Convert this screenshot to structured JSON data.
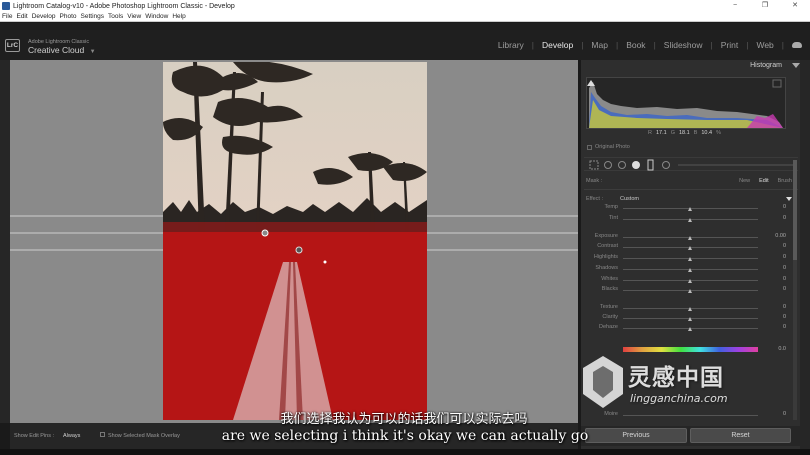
{
  "window": {
    "title": "Lightroom Catalog-v10 - Adobe Photoshop Lightroom Classic - Develop",
    "controls": [
      "−",
      "❐",
      "✕"
    ]
  },
  "menubar": [
    "File",
    "Edit",
    "Develop",
    "Photo",
    "Settings",
    "Tools",
    "View",
    "Window",
    "Help"
  ],
  "identity_plate": {
    "badge": "LrC",
    "line1": "Adobe Lightroom Classic",
    "line2": "Creative Cloud",
    "dropdown": "▼"
  },
  "modules": {
    "items": [
      "Library",
      "Develop",
      "Map",
      "Book",
      "Slideshow",
      "Print",
      "Web"
    ],
    "active": "Develop",
    "separator": "|"
  },
  "toolbar": {
    "show_edit_pins_label": "Show Edit Pins :",
    "show_edit_pins_value": "Always",
    "show_overlay_label": "Show Selected Mask Overlay",
    "show_overlay_checked": true
  },
  "histogram": {
    "title": "Histogram",
    "r_label": "R",
    "r_value": "17.1",
    "g_label": "G",
    "g_value": "18.1",
    "b_label": "B",
    "b_value": "10.4",
    "unit": "%",
    "original_photo": "Original Photo"
  },
  "mask": {
    "label": "Mask :",
    "new": "New",
    "edit": "Edit",
    "brush": "Brush",
    "active": "Edit"
  },
  "effect": {
    "label": "Effect :",
    "value": "Custom"
  },
  "sliders": [
    {
      "label": "Temp",
      "value": "0",
      "pos": 0.5
    },
    {
      "label": "Tint",
      "value": "0",
      "pos": 0.5
    },
    {
      "label": "Exposure",
      "value": "0.00",
      "pos": 0.5
    },
    {
      "label": "Contrast",
      "value": "0",
      "pos": 0.5
    },
    {
      "label": "Highlights",
      "value": "0",
      "pos": 0.5
    },
    {
      "label": "Shadows",
      "value": "0",
      "pos": 0.5
    },
    {
      "label": "Whites",
      "value": "0",
      "pos": 0.5
    },
    {
      "label": "Blacks",
      "value": "0",
      "pos": 0.5
    },
    {
      "label": "Texture",
      "value": "0",
      "pos": 0.5
    },
    {
      "label": "Clarity",
      "value": "0",
      "pos": 0.5
    },
    {
      "label": "Dehaze",
      "value": "0",
      "pos": 0.5
    }
  ],
  "hue": {
    "value": "0.0",
    "pos": 0.5
  },
  "lower_sliders": [
    {
      "label": "Moire",
      "value": "0",
      "pos": 0.5
    }
  ],
  "buttons": {
    "previous": "Previous",
    "reset": "Reset"
  },
  "subtitles": {
    "zh": "我们选择我认为可以的话我们可以实际去吗",
    "en": "are we selecting i think it's okay we can actually go"
  },
  "watermark": {
    "zh": "灵感中国",
    "url": "lingganchina.com"
  },
  "colors": {
    "accent": "#c11a1a",
    "panel": "#2e2e2e",
    "canvas": "#8a8a8a"
  }
}
